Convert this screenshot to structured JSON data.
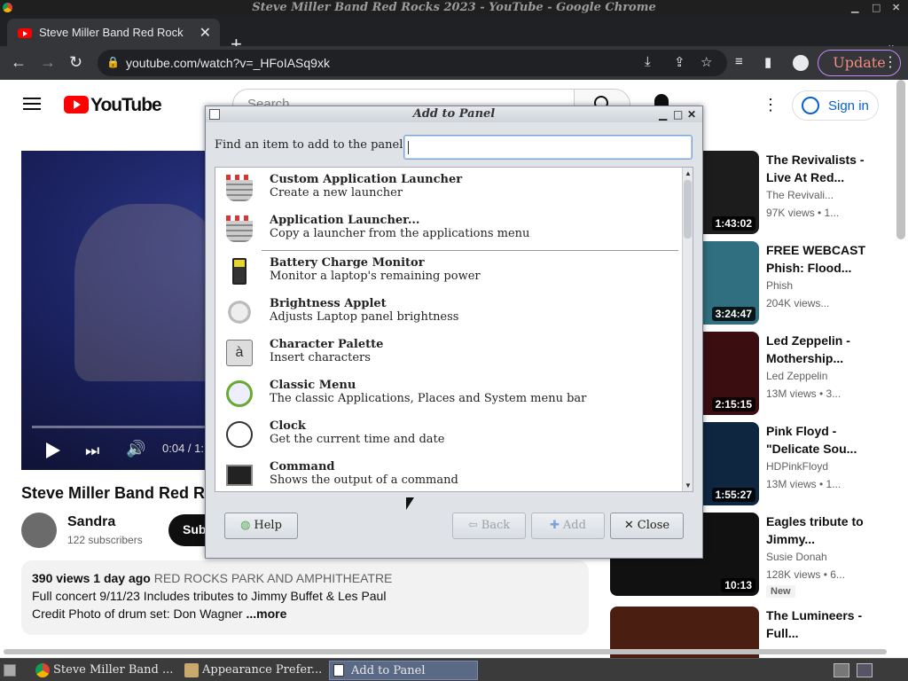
{
  "window": {
    "title": "Steve Miller Band Red Rocks 2023 - YouTube - Google Chrome"
  },
  "tab": {
    "title": "Steve Miller Band Red Rock"
  },
  "omnibox": {
    "url": "youtube.com/watch?v=_HFoIASq9xk"
  },
  "toolbar": {
    "update_label": "Update"
  },
  "youtube": {
    "logo_text": "YouTube",
    "search_placeholder": "Search",
    "signin_label": "Sign in",
    "video_title": "Steve Miller Band Red Rocks 2023",
    "time": "0:04 / 1:",
    "channel": "Sandra",
    "subscribers": "122 subscribers",
    "subscribe_label": "Subscribe",
    "desc_meta": "390 views  1 day ago",
    "desc_location": "RED ROCKS PARK AND AMPHITHEATRE",
    "desc_line1": "Full concert 9/11/23 Includes tributes  to Jimmy Buffet & Les Paul",
    "desc_line2": "Credit Photo of drum set: Don Wagner",
    "more_label": "...more",
    "related": [
      {
        "title": "The Revivalists - Live At Red...",
        "channel": "The Revivali...",
        "meta": "97K views  • 1...",
        "duration": "1:43:02",
        "color": "#1c1c1c",
        "badge": ""
      },
      {
        "title": "FREE WEBCAST Phish: Flood...",
        "channel": "Phish",
        "meta": "204K views...",
        "duration": "3:24:47",
        "color": "#2f6f7f",
        "badge": ""
      },
      {
        "title": "Led Zeppelin - Mothership...",
        "channel": "Led Zeppelin",
        "meta": "13M views  • 3...",
        "duration": "2:15:15",
        "color": "#3a0e10",
        "badge": ""
      },
      {
        "title": "Pink Floyd - \"Delicate Sou...",
        "channel": "HDPinkFloyd",
        "meta": "13M views  • 1...",
        "duration": "1:55:27",
        "color": "#0f2640",
        "badge": ""
      },
      {
        "title": "Eagles tribute to Jimmy...",
        "channel": "Susie Donah",
        "meta": "128K views  • 6...",
        "duration": "10:13",
        "color": "#111111",
        "badge": "New"
      },
      {
        "title": "The Lumineers - Full...",
        "channel": "",
        "meta": "",
        "duration": "",
        "color": "#4a1f12",
        "badge": ""
      }
    ]
  },
  "dialog": {
    "title": "Add to Panel",
    "find_label": "Find an item to add to the panel:",
    "find_value": "",
    "items": [
      {
        "name": "Custom Application Launcher",
        "desc": "Create a new launcher",
        "icon": "launcher-icon"
      },
      {
        "name": "Application Launcher...",
        "desc": "Copy a launcher from the applications menu",
        "icon": "launcher-icon"
      },
      {
        "name": "Battery Charge Monitor",
        "desc": "Monitor a laptop's remaining power",
        "icon": "battery-icon"
      },
      {
        "name": "Brightness Applet",
        "desc": "Adjusts Laptop panel brightness",
        "icon": "brightness-icon"
      },
      {
        "name": "Character Palette",
        "desc": "Insert characters",
        "icon": "character-palette-icon"
      },
      {
        "name": "Classic Menu",
        "desc": "The classic Applications, Places and System menu bar",
        "icon": "classic-menu-icon"
      },
      {
        "name": "Clock",
        "desc": "Get the current time and date",
        "icon": "clock-icon"
      },
      {
        "name": "Command",
        "desc": "Shows the output of a command",
        "icon": "command-icon"
      }
    ],
    "char_glyph": "à",
    "help_label": "Help",
    "back_label": "Back",
    "add_label": "Add",
    "close_label": "Close"
  },
  "taskbar": {
    "items": [
      {
        "label": "Steve Miller Band ..."
      },
      {
        "label": "Appearance Prefer..."
      },
      {
        "label": "Add to Panel"
      }
    ]
  }
}
